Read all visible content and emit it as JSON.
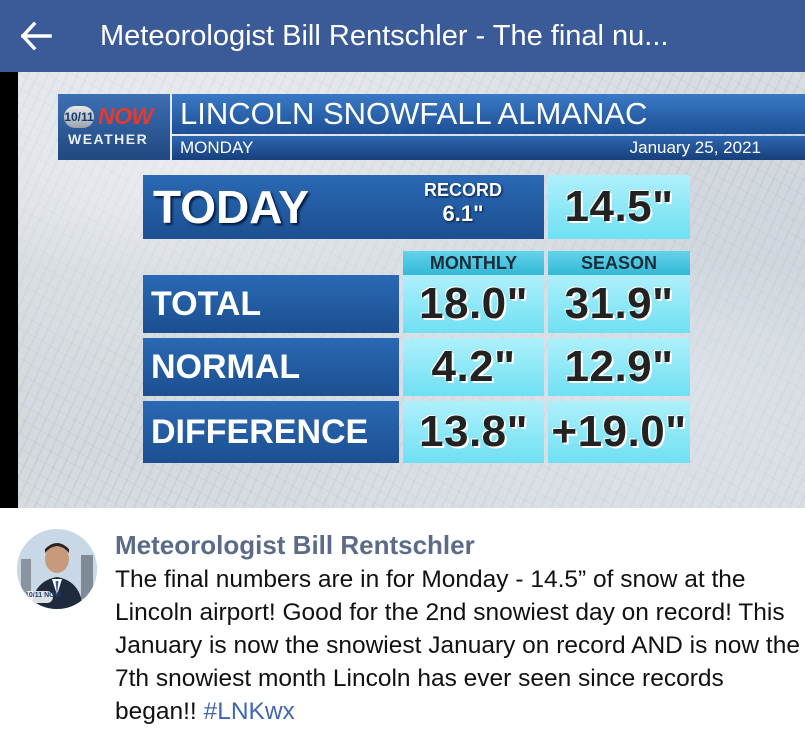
{
  "appbar": {
    "title": "Meteorologist Bill Rentschler - The final nu...",
    "back_icon": "arrow-left-icon"
  },
  "graphic": {
    "logo": {
      "badge": "10/11",
      "now": "NOW",
      "weather": "WEATHER"
    },
    "title": "LINCOLN SNOWFALL ALMANAC",
    "day": "MONDAY",
    "date": "January 25, 2021",
    "today": {
      "label": "TODAY",
      "record_label": "RECORD",
      "record_value": "6.1\"",
      "value": "14.5\""
    },
    "columns": {
      "monthly": "MONTHLY",
      "season": "SEASON"
    },
    "rows": [
      {
        "label": "TOTAL",
        "monthly": "18.0\"",
        "season": "31.9\""
      },
      {
        "label": "NORMAL",
        "monthly": "4.2\"",
        "season": "12.9\""
      },
      {
        "label": "DIFFERENCE",
        "monthly": "13.8\"",
        "season": "+19.0\""
      }
    ]
  },
  "post": {
    "author": "Meteorologist Bill Rentschler",
    "avatar_badge": "10/11 NOW",
    "text": "The final numbers are in for Monday - 14.5” of snow at the Lincoln airport! Good for the 2nd snowiest day on record! This January is now the snowiest January on record AND is now the 7th snowiest month Lincoln has ever seen since records began!! ",
    "hashtag": "#LNKwx"
  },
  "colors": {
    "appbar": "#3b5a98",
    "graphic_blue": "#1d4f95",
    "graphic_cyan": "#6fe0f3",
    "author": "#5b6b88",
    "hashtag": "#4267b2"
  }
}
